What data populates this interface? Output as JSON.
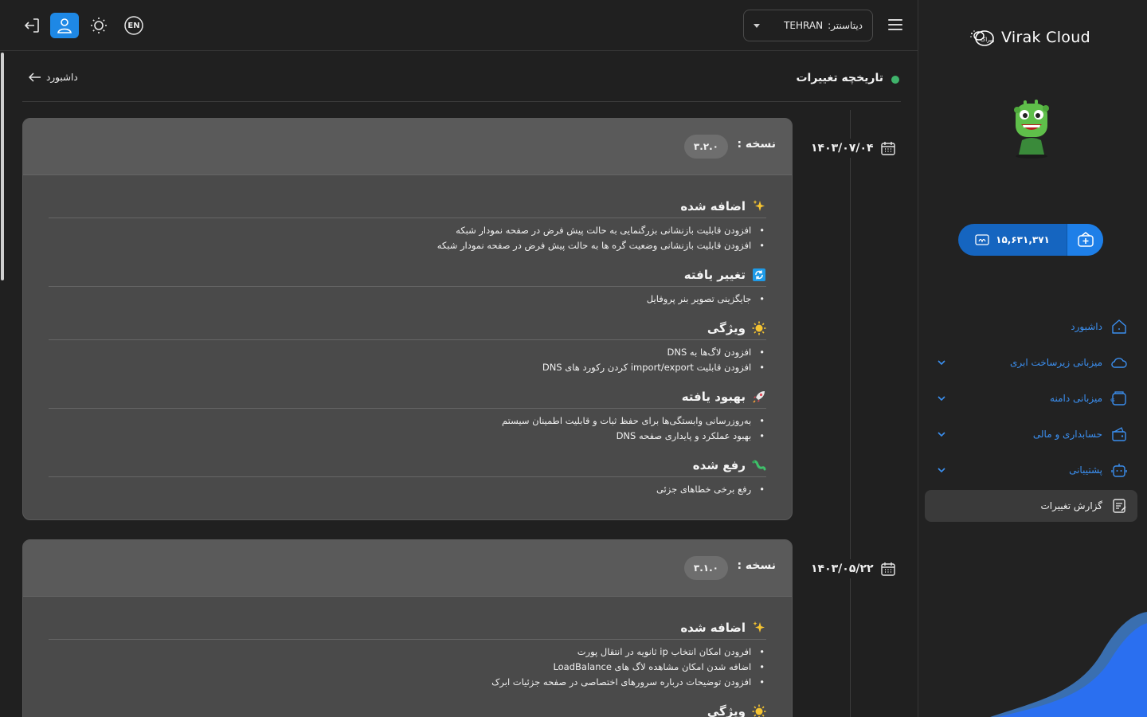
{
  "sidebar": {
    "brand": "Virak Cloud",
    "wallet_balance": "۱۵,۶۳۱,۳۷۱",
    "nav": [
      {
        "label": "داشبورد",
        "has_chevron": false
      },
      {
        "label": "میزبانی زیرساخت ابری",
        "has_chevron": true
      },
      {
        "label": "میزبانی دامنه",
        "has_chevron": true
      },
      {
        "label": "حسابداری و مالی",
        "has_chevron": true
      },
      {
        "label": "پشتیبانی",
        "has_chevron": true
      },
      {
        "label": "گزارش تغییرات",
        "has_chevron": false,
        "active": true
      }
    ]
  },
  "topbar": {
    "language": "EN",
    "datacenter_label": "دیتاسنتر:",
    "datacenter_value": "TEHRAN"
  },
  "page": {
    "title": "تاریخچه تغییرات",
    "back_label": "داشبورد"
  },
  "version_label": "نسخه :",
  "releases": [
    {
      "date": "۱۴۰۳/۰۷/۰۴",
      "version": "۳.۲.۰",
      "sections": [
        {
          "title": "اضافه شده",
          "icon": "sparkles-icon",
          "items": [
            "افزودن قابلیت بازنشانی بزرگنمایی به حالت پیش فرض در صفحه نمودار شبکه",
            "افزودن قابلیت بازنشانی وضعیت گره ها به حالت پیش فرض در صفحه نمودار شبکه"
          ]
        },
        {
          "title": "تغییر یافته",
          "icon": "refresh-icon",
          "items": [
            "جایگزینی تصویر بنر پروفایل"
          ]
        },
        {
          "title": "ویژگی",
          "icon": "sun-icon",
          "items": [
            "افزودن لاگ‌ها به DNS",
            "افزودن قابلیت import/export کردن رکورد های DNS"
          ]
        },
        {
          "title": "بهبود یافته",
          "icon": "rocket-icon",
          "items": [
            "به‌روزرسانی وابستگی‌ها برای حفظ ثبات و قابلیت اطمینان سیستم",
            "بهبود عملکرد و پایداری صفحه DNS"
          ]
        },
        {
          "title": "رفع شده",
          "icon": "bug-icon",
          "items": [
            "رفع برخی خطاهای جزئی"
          ]
        }
      ]
    },
    {
      "date": "۱۴۰۳/۰۵/۲۲",
      "version": "۳.۱.۰",
      "sections": [
        {
          "title": "اضافه شده",
          "icon": "sparkles-icon",
          "items": [
            "افرودن امکان انتخاب ip ثانویه در انتقال پورت",
            "اضافه شدن امکان مشاهده لاگ های LoadBalance",
            "افزودن توضیحات درباره سرورهای اختصاصی در صفحه جزئیات ابرک"
          ]
        },
        {
          "title": "ویژگی",
          "icon": "sun-icon",
          "items": []
        }
      ]
    }
  ],
  "colors": {
    "accent": "#1e88e5",
    "nav_link": "#3b8ff0",
    "status_dot": "#3fb36b",
    "card_bg": "#4a4a4a",
    "card_head_bg": "#5a5a5a"
  }
}
